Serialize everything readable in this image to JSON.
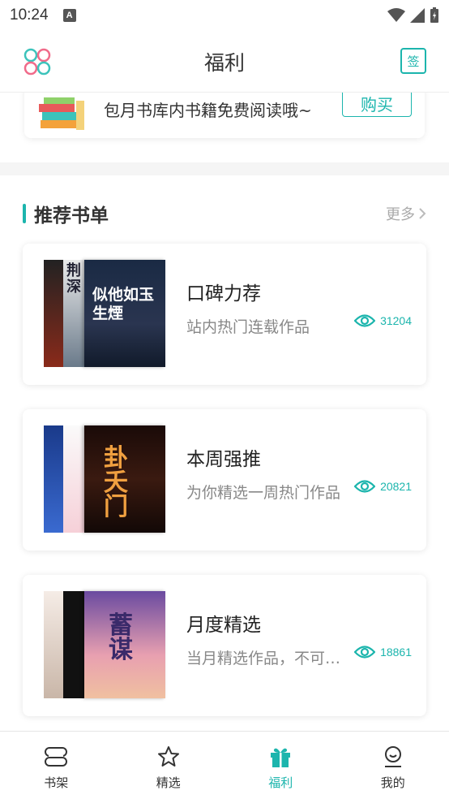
{
  "status": {
    "time": "10:24",
    "notif": "A"
  },
  "header": {
    "title": "福利",
    "left_icon": "apps-grid-icon",
    "right_icon": "sign-in-calendar-icon",
    "sign_label": "签"
  },
  "promo": {
    "text": "包月书库内书籍免费阅读哦~",
    "buy_label": "购买"
  },
  "recommend": {
    "title": "推荐书单",
    "more_label": "更多",
    "cards": [
      {
        "title": "口碑力荐",
        "desc": "站内热门连载作品",
        "views": "31204",
        "cover_text": "似他如玉生煙",
        "back_text": "荆深"
      },
      {
        "title": "本周强推",
        "desc": "为你精选一周热门作品",
        "views": "20821",
        "cover_text": "卦夭门",
        "back_text": ""
      },
      {
        "title": "月度精选",
        "desc": "当月精选作品，不可…",
        "views": "18861",
        "cover_text": "蓄谋",
        "back_text": ""
      }
    ]
  },
  "nav": {
    "items": [
      {
        "label": "书架",
        "icon": "bookshelf-icon"
      },
      {
        "label": "精选",
        "icon": "star-icon"
      },
      {
        "label": "福利",
        "icon": "gift-icon"
      },
      {
        "label": "我的",
        "icon": "profile-icon"
      }
    ],
    "active_index": 2
  },
  "colors": {
    "accent": "#1cb5ad",
    "text": "#222222",
    "muted": "#888888"
  }
}
